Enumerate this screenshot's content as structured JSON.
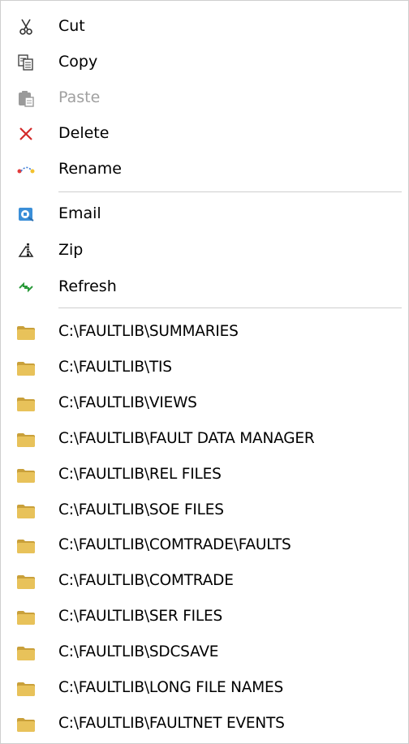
{
  "menu": {
    "actions": [
      {
        "label": "Cut",
        "icon": "scissors-icon",
        "enabled": true
      },
      {
        "label": "Copy",
        "icon": "copy-icon",
        "enabled": true
      },
      {
        "label": "Paste",
        "icon": "paste-icon",
        "enabled": false
      },
      {
        "label": "Delete",
        "icon": "delete-x-icon",
        "enabled": true
      },
      {
        "label": "Rename",
        "icon": "rename-icon",
        "enabled": true
      }
    ],
    "tools": [
      {
        "label": "Email",
        "icon": "email-icon"
      },
      {
        "label": "Zip",
        "icon": "zip-icon"
      },
      {
        "label": "Refresh",
        "icon": "refresh-icon"
      }
    ],
    "folders": [
      "C:\\FAULTLIB\\SUMMARIES",
      "C:\\FAULTLIB\\TIS",
      "C:\\FAULTLIB\\VIEWS",
      "C:\\FAULTLIB\\FAULT DATA MANAGER",
      "C:\\FAULTLIB\\REL FILES",
      "C:\\FAULTLIB\\SOE FILES",
      "C:\\FAULTLIB\\COMTRADE\\FAULTS",
      "C:\\FAULTLIB\\COMTRADE",
      "C:\\FAULTLIB\\SER FILES",
      "C:\\FAULTLIB\\SDCSAVE",
      "C:\\FAULTLIB\\LONG FILE NAMES",
      "C:\\FAULTLIB\\FAULTNET EVENTS"
    ]
  },
  "colors": {
    "separator": "#cfcfcf",
    "disabled_text": "#a0a0a0",
    "delete_red": "#d32a2a",
    "folder_fill": "#e8c25a",
    "folder_dark": "#c9a03a"
  }
}
